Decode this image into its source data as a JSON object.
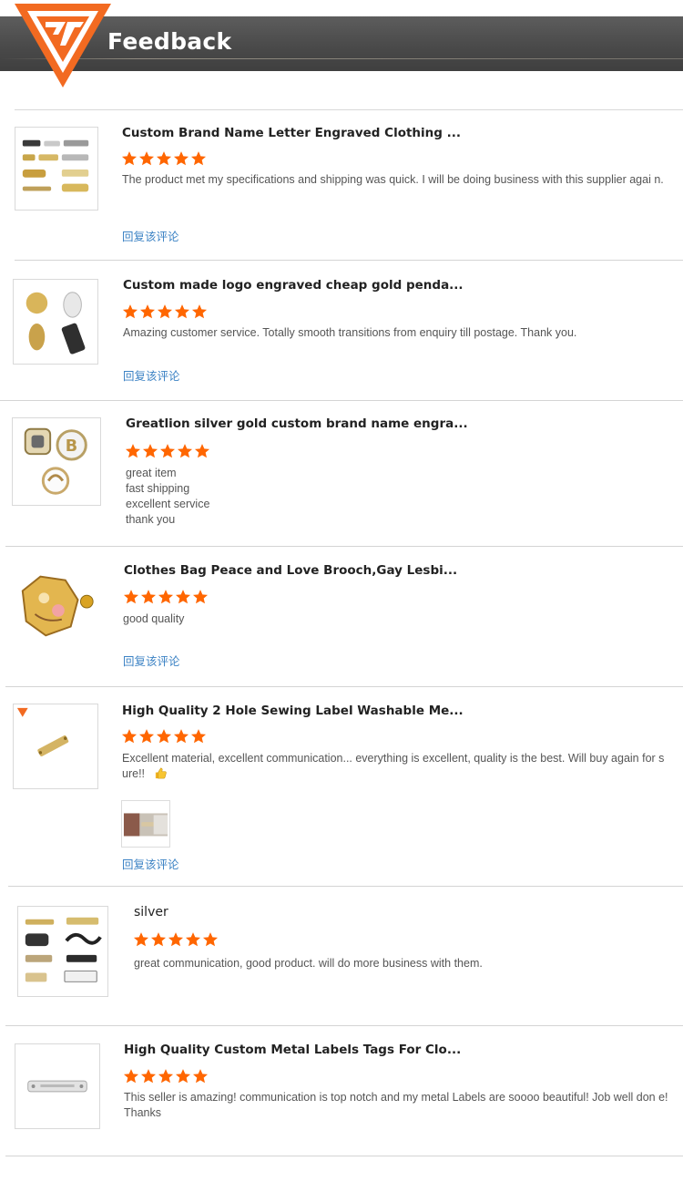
{
  "header": {
    "title": "Feedback"
  },
  "colors": {
    "star": "#ff6600",
    "brand_orange": "#f26a21",
    "reply_link": "#3b82c4",
    "banner": "#4a4a4a"
  },
  "reviews": [
    {
      "thumb_icon": "engraved-letter-labels-thumbnail",
      "title": "Custom Brand Name Letter Engraved Clothing ...",
      "rating": 5,
      "comment": "The product met my specifications and shipping was quick. I will be doing business with this supplier agai n.",
      "reply": "回复该评论"
    },
    {
      "thumb_icon": "gold-pendant-tags-thumbnail",
      "title": "Custom made logo engraved cheap gold penda...",
      "rating": 5,
      "comment": "Amazing customer service. Totally smooth transitions from enquiry till postage. Thank you.",
      "reply": "回复该评论"
    },
    {
      "thumb_icon": "silver-gold-brand-charms-thumbnail",
      "title": "Greatlion silver gold custom brand name engra...",
      "rating": 5,
      "comment_lines": [
        "great item",
        "fast shipping",
        "excellent service",
        "thank you"
      ]
    },
    {
      "thumb_icon": "enamel-brooch-thumbnail",
      "title": "Clothes Bag Peace and Love Brooch,Gay Lesbi...",
      "rating": 5,
      "comment": "good quality",
      "reply": "回复该评论"
    },
    {
      "thumb_icon": "sewing-label-thumbnail",
      "title": "High Quality 2 Hole Sewing Label Washable Me...",
      "rating": 5,
      "comment": "Excellent material, excellent communication... everything is excellent, quality is the best. Will buy again for s ure!!",
      "emoji_icon": "thumbs-up-emoji-icon",
      "photo_icon": "customer-photo-thumbnail",
      "reply": "回复该评论"
    },
    {
      "thumb_icon": "metal-labels-assortment-thumbnail",
      "title": "silver",
      "rating": 5,
      "comment": "great communication, good product. will do more business with them."
    },
    {
      "thumb_icon": "silver-metal-tag-thumbnail",
      "title": "High Quality Custom Metal Labels Tags For Clo...",
      "rating": 5,
      "comment": "This seller is amazing! communication is top notch and my metal Labels are soooo beautiful! Job well don e! Thanks"
    }
  ]
}
